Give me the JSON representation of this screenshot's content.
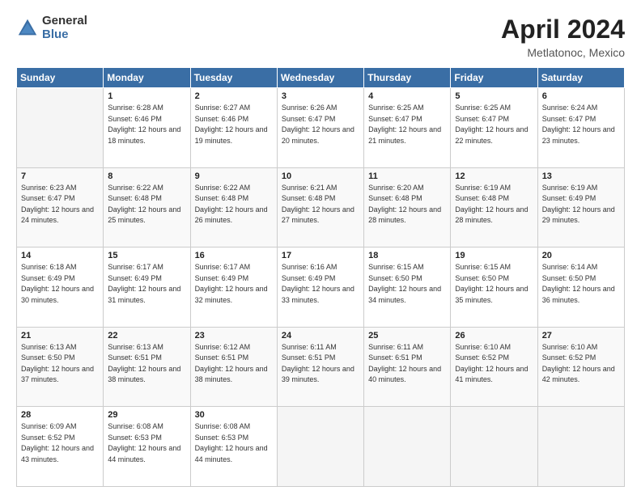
{
  "header": {
    "logo_general": "General",
    "logo_blue": "Blue",
    "title": "April 2024",
    "location": "Metlatonoc, Mexico"
  },
  "days_of_week": [
    "Sunday",
    "Monday",
    "Tuesday",
    "Wednesday",
    "Thursday",
    "Friday",
    "Saturday"
  ],
  "weeks": [
    [
      {
        "day": "",
        "sunrise": "",
        "sunset": "",
        "daylight": ""
      },
      {
        "day": "1",
        "sunrise": "Sunrise: 6:28 AM",
        "sunset": "Sunset: 6:46 PM",
        "daylight": "Daylight: 12 hours and 18 minutes."
      },
      {
        "day": "2",
        "sunrise": "Sunrise: 6:27 AM",
        "sunset": "Sunset: 6:46 PM",
        "daylight": "Daylight: 12 hours and 19 minutes."
      },
      {
        "day": "3",
        "sunrise": "Sunrise: 6:26 AM",
        "sunset": "Sunset: 6:47 PM",
        "daylight": "Daylight: 12 hours and 20 minutes."
      },
      {
        "day": "4",
        "sunrise": "Sunrise: 6:25 AM",
        "sunset": "Sunset: 6:47 PM",
        "daylight": "Daylight: 12 hours and 21 minutes."
      },
      {
        "day": "5",
        "sunrise": "Sunrise: 6:25 AM",
        "sunset": "Sunset: 6:47 PM",
        "daylight": "Daylight: 12 hours and 22 minutes."
      },
      {
        "day": "6",
        "sunrise": "Sunrise: 6:24 AM",
        "sunset": "Sunset: 6:47 PM",
        "daylight": "Daylight: 12 hours and 23 minutes."
      }
    ],
    [
      {
        "day": "7",
        "sunrise": "Sunrise: 6:23 AM",
        "sunset": "Sunset: 6:47 PM",
        "daylight": "Daylight: 12 hours and 24 minutes."
      },
      {
        "day": "8",
        "sunrise": "Sunrise: 6:22 AM",
        "sunset": "Sunset: 6:48 PM",
        "daylight": "Daylight: 12 hours and 25 minutes."
      },
      {
        "day": "9",
        "sunrise": "Sunrise: 6:22 AM",
        "sunset": "Sunset: 6:48 PM",
        "daylight": "Daylight: 12 hours and 26 minutes."
      },
      {
        "day": "10",
        "sunrise": "Sunrise: 6:21 AM",
        "sunset": "Sunset: 6:48 PM",
        "daylight": "Daylight: 12 hours and 27 minutes."
      },
      {
        "day": "11",
        "sunrise": "Sunrise: 6:20 AM",
        "sunset": "Sunset: 6:48 PM",
        "daylight": "Daylight: 12 hours and 28 minutes."
      },
      {
        "day": "12",
        "sunrise": "Sunrise: 6:19 AM",
        "sunset": "Sunset: 6:48 PM",
        "daylight": "Daylight: 12 hours and 28 minutes."
      },
      {
        "day": "13",
        "sunrise": "Sunrise: 6:19 AM",
        "sunset": "Sunset: 6:49 PM",
        "daylight": "Daylight: 12 hours and 29 minutes."
      }
    ],
    [
      {
        "day": "14",
        "sunrise": "Sunrise: 6:18 AM",
        "sunset": "Sunset: 6:49 PM",
        "daylight": "Daylight: 12 hours and 30 minutes."
      },
      {
        "day": "15",
        "sunrise": "Sunrise: 6:17 AM",
        "sunset": "Sunset: 6:49 PM",
        "daylight": "Daylight: 12 hours and 31 minutes."
      },
      {
        "day": "16",
        "sunrise": "Sunrise: 6:17 AM",
        "sunset": "Sunset: 6:49 PM",
        "daylight": "Daylight: 12 hours and 32 minutes."
      },
      {
        "day": "17",
        "sunrise": "Sunrise: 6:16 AM",
        "sunset": "Sunset: 6:49 PM",
        "daylight": "Daylight: 12 hours and 33 minutes."
      },
      {
        "day": "18",
        "sunrise": "Sunrise: 6:15 AM",
        "sunset": "Sunset: 6:50 PM",
        "daylight": "Daylight: 12 hours and 34 minutes."
      },
      {
        "day": "19",
        "sunrise": "Sunrise: 6:15 AM",
        "sunset": "Sunset: 6:50 PM",
        "daylight": "Daylight: 12 hours and 35 minutes."
      },
      {
        "day": "20",
        "sunrise": "Sunrise: 6:14 AM",
        "sunset": "Sunset: 6:50 PM",
        "daylight": "Daylight: 12 hours and 36 minutes."
      }
    ],
    [
      {
        "day": "21",
        "sunrise": "Sunrise: 6:13 AM",
        "sunset": "Sunset: 6:50 PM",
        "daylight": "Daylight: 12 hours and 37 minutes."
      },
      {
        "day": "22",
        "sunrise": "Sunrise: 6:13 AM",
        "sunset": "Sunset: 6:51 PM",
        "daylight": "Daylight: 12 hours and 38 minutes."
      },
      {
        "day": "23",
        "sunrise": "Sunrise: 6:12 AM",
        "sunset": "Sunset: 6:51 PM",
        "daylight": "Daylight: 12 hours and 38 minutes."
      },
      {
        "day": "24",
        "sunrise": "Sunrise: 6:11 AM",
        "sunset": "Sunset: 6:51 PM",
        "daylight": "Daylight: 12 hours and 39 minutes."
      },
      {
        "day": "25",
        "sunrise": "Sunrise: 6:11 AM",
        "sunset": "Sunset: 6:51 PM",
        "daylight": "Daylight: 12 hours and 40 minutes."
      },
      {
        "day": "26",
        "sunrise": "Sunrise: 6:10 AM",
        "sunset": "Sunset: 6:52 PM",
        "daylight": "Daylight: 12 hours and 41 minutes."
      },
      {
        "day": "27",
        "sunrise": "Sunrise: 6:10 AM",
        "sunset": "Sunset: 6:52 PM",
        "daylight": "Daylight: 12 hours and 42 minutes."
      }
    ],
    [
      {
        "day": "28",
        "sunrise": "Sunrise: 6:09 AM",
        "sunset": "Sunset: 6:52 PM",
        "daylight": "Daylight: 12 hours and 43 minutes."
      },
      {
        "day": "29",
        "sunrise": "Sunrise: 6:08 AM",
        "sunset": "Sunset: 6:53 PM",
        "daylight": "Daylight: 12 hours and 44 minutes."
      },
      {
        "day": "30",
        "sunrise": "Sunrise: 6:08 AM",
        "sunset": "Sunset: 6:53 PM",
        "daylight": "Daylight: 12 hours and 44 minutes."
      },
      {
        "day": "",
        "sunrise": "",
        "sunset": "",
        "daylight": ""
      },
      {
        "day": "",
        "sunrise": "",
        "sunset": "",
        "daylight": ""
      },
      {
        "day": "",
        "sunrise": "",
        "sunset": "",
        "daylight": ""
      },
      {
        "day": "",
        "sunrise": "",
        "sunset": "",
        "daylight": ""
      }
    ]
  ]
}
